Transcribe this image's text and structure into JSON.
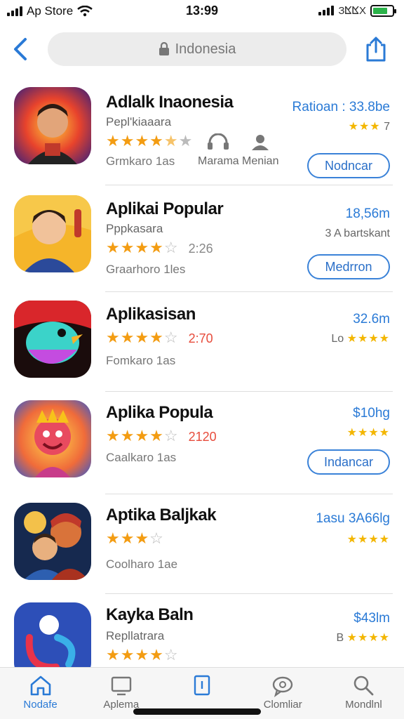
{
  "status_bar": {
    "carrier": "Ap Store",
    "time": "13:99",
    "right_text": "ЗⴿⴿΧ",
    "battery_level": 0.75
  },
  "nav": {
    "search_text": "Indonesia"
  },
  "apps": [
    {
      "name": "Adlalk Inaonesia",
      "subtitle": "Pepl'kiaaara",
      "stars_full": "★★★★",
      "stars_half": "★",
      "stars_empty": "★",
      "rating_count": "",
      "note": "Grmkaro 1as",
      "meta_primary": "Ratioan : 33.8be",
      "meta_secondary_stars": "★★★",
      "meta_secondary_text": "7",
      "button_label": "Nodncar",
      "extras": [
        {
          "label": "Marama",
          "icon": "headset-icon"
        },
        {
          "label": "Menian",
          "icon": "person-icon"
        }
      ]
    },
    {
      "name": "Aplikai Popular",
      "subtitle": "Pppkasara",
      "stars_full": "★★★★",
      "stars_half": "",
      "stars_empty": "☆",
      "rating_count": "2:26",
      "note": "Graarhoro 1les",
      "meta_primary": "18,56m",
      "meta_secondary_stars": "",
      "meta_secondary_text": "3  A bartskant",
      "button_label": "Medrron"
    },
    {
      "name": "Aplikasisan",
      "subtitle": "",
      "stars_full": "★★★★",
      "stars_half": "",
      "stars_empty": "☆",
      "rating_count": "2:70",
      "note": "Fomkaro 1as",
      "meta_primary": "32.6m",
      "meta_secondary_stars": "★★★★",
      "meta_secondary_text": "Lo",
      "button_label": ""
    },
    {
      "name": "Aplika Popula",
      "subtitle": "",
      "stars_full": "★★★★",
      "stars_half": "",
      "stars_empty": "☆",
      "rating_count": "2120",
      "note": "Caalkaro 1as",
      "meta_primary": "$10hg",
      "meta_secondary_stars": "★★★★",
      "meta_secondary_text": "",
      "button_label": "Indancar"
    },
    {
      "name": "Aptika Baljkak",
      "subtitle": "",
      "stars_full": "★★★",
      "stars_half": "",
      "stars_empty": "☆",
      "rating_count": "",
      "note": "Coolharo 1ae",
      "meta_primary": "1asu  3A66lg",
      "meta_secondary_stars": "★★★★",
      "meta_secondary_text": "",
      "button_label": ""
    },
    {
      "name": "Kayka Baln",
      "subtitle": "Repllatrara",
      "stars_full": "★★★★",
      "stars_half": "",
      "stars_empty": "☆",
      "rating_count": "",
      "note": "",
      "meta_primary": "$43lm",
      "meta_secondary_stars": "★★★★",
      "meta_secondary_text": "B",
      "button_label": ""
    }
  ],
  "tabs": [
    {
      "label": "Nodafe",
      "icon": "home-icon",
      "active": true
    },
    {
      "label": "Aplema",
      "icon": "tv-icon",
      "active": false
    },
    {
      "label": "",
      "icon": "book-icon",
      "active": false
    },
    {
      "label": "Clomliar",
      "icon": "chat-icon",
      "active": false
    },
    {
      "label": "Mondlnl",
      "icon": "search-icon",
      "active": false
    }
  ],
  "colors": {
    "accent": "#2a7ad6",
    "star": "#f39c12",
    "rating_red": "#e74c3c"
  }
}
